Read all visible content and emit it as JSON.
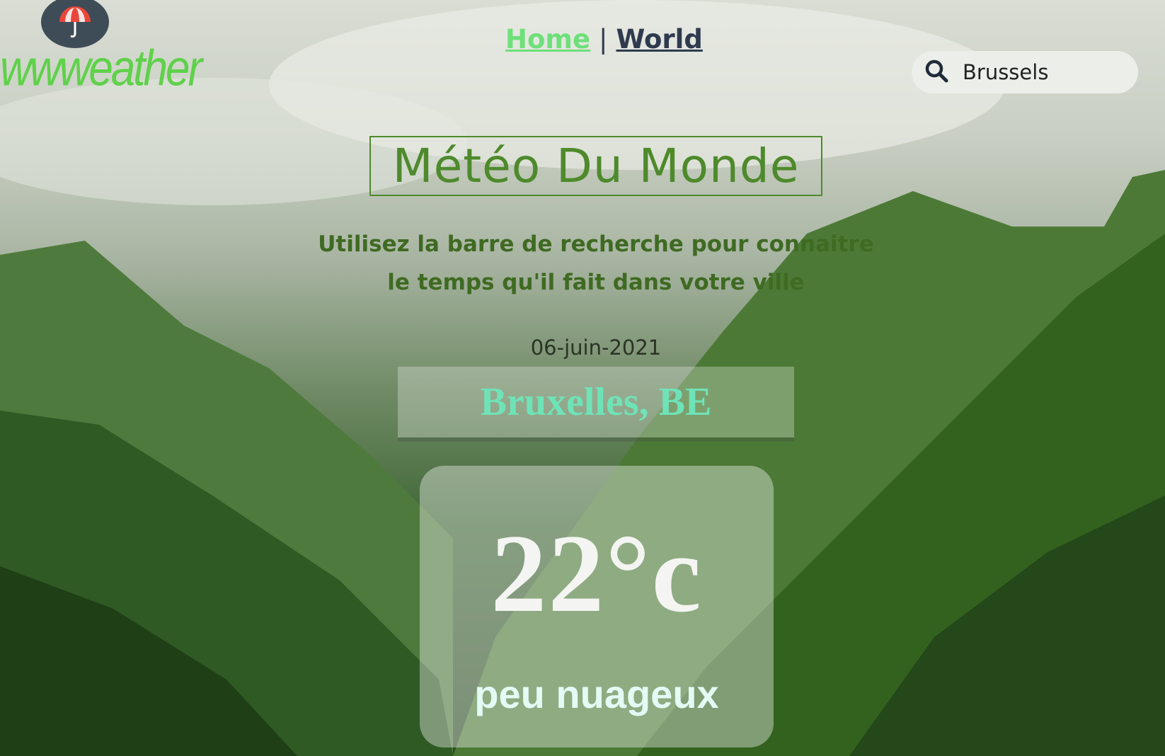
{
  "brand": {
    "name": "wwweather",
    "logo_icon": "umbrella-icon"
  },
  "nav": {
    "home_label": "Home",
    "separator": "|",
    "world_label": "World"
  },
  "search": {
    "value": "Brussels",
    "icon": "search-icon"
  },
  "main": {
    "title": "Météo Du Monde",
    "subtitle_line1": "Utilisez la barre de recherche pour connaitre",
    "subtitle_line2": "le temps qu'il fait dans votre ville",
    "date": "06-juin-2021",
    "city": "Bruxelles, BE",
    "temperature": "22°c",
    "description": "peu nuageux"
  },
  "colors": {
    "accent_green": "#4e8a2c",
    "nav_home": "#6ee07a",
    "nav_world": "#2f3a4f",
    "city_text": "#6fe3b8",
    "logo_text": "#5fd14a"
  }
}
